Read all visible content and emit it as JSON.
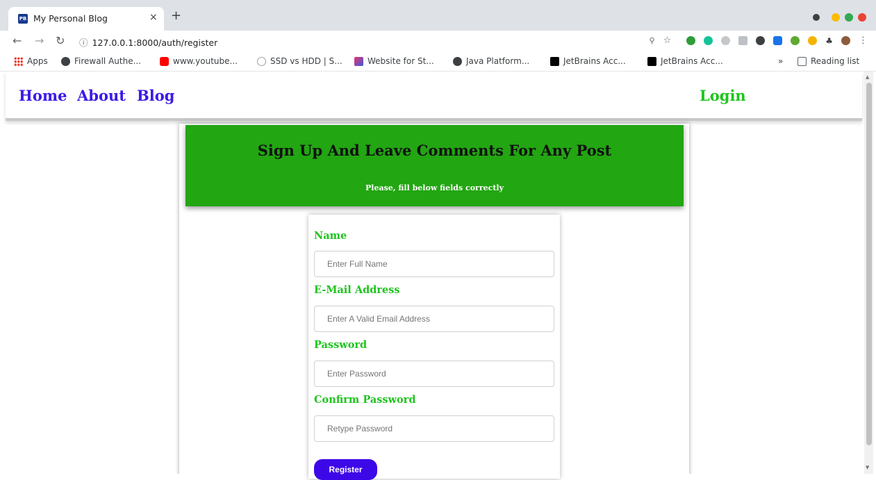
{
  "browser": {
    "tab_favicon": "PB",
    "tab_title": "My Personal Blog",
    "tab_close": "×",
    "new_tab": "+",
    "url": "127.0.0.1:8000/auth/register",
    "bookmarks": [
      {
        "label": "Apps",
        "icon": "apps-grid-icon",
        "color": "#e94235"
      },
      {
        "label": "Firewall Authe...",
        "icon": "globe-icon",
        "color": "#3c4043"
      },
      {
        "label": "www.youtube...",
        "icon": "youtube-icon",
        "color": "#ff0000"
      },
      {
        "label": "SSD vs HDD | S...",
        "icon": "site-icon",
        "color": "#9aa0a6"
      },
      {
        "label": "Website for St...",
        "icon": "w-logo-icon",
        "color": "#e8336c"
      },
      {
        "label": "Java Platform...",
        "icon": "globe-icon",
        "color": "#3c4043"
      },
      {
        "label": "JetBrains Acc...",
        "icon": "jetbrains-icon",
        "color": "#000000"
      },
      {
        "label": "JetBrains Acc...",
        "icon": "jetbrains-icon",
        "color": "#000000"
      }
    ],
    "bookmarks_overflow": "»",
    "reading_list": "Reading list"
  },
  "nav": {
    "home": "Home",
    "about": "About",
    "blog": "Blog",
    "login": "Login",
    "link_color": "#3d19e6",
    "login_color": "#1fc41f"
  },
  "banner": {
    "title": "Sign Up And Leave Comments For Any Post",
    "subtitle": "Please, fill below fields correctly",
    "bg_color": "#22a612"
  },
  "form": {
    "name_label": "Name",
    "name_placeholder": "Enter Full Name",
    "email_label": "E-Mail Address",
    "email_placeholder": "Enter A Valid Email Address",
    "password_label": "Password",
    "password_placeholder": "Enter Password",
    "confirm_label": "Confirm Password",
    "confirm_placeholder": "Retype Password",
    "register_label": "Register",
    "button_color": "#3d08e8"
  }
}
